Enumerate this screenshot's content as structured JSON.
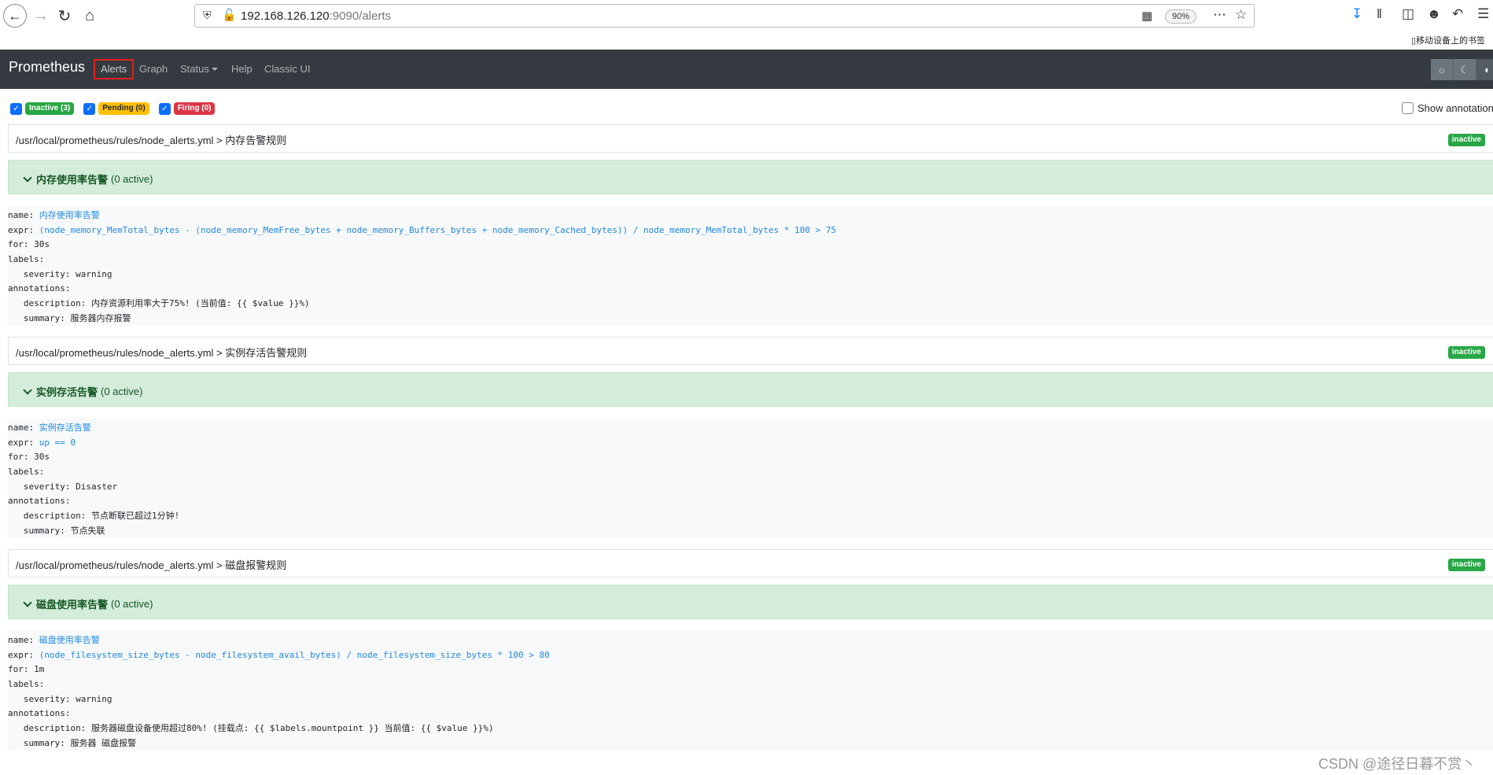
{
  "browser": {
    "url_host": "192.168.126.120",
    "url_rest": ":9090/alerts",
    "zoom": "90%",
    "mobile_bookmarks": "移动设备上的书签"
  },
  "navbar": {
    "brand": "Prometheus",
    "links": [
      "Alerts",
      "Graph",
      "Status",
      "Help",
      "Classic UI"
    ]
  },
  "filters": {
    "inactive": "Inactive (3)",
    "pending": "Pending (0)",
    "firing": "Firing (0)",
    "show_annotations": "Show annotations"
  },
  "groups": [
    {
      "path": "/usr/local/prometheus/rules/node_alerts.yml > 内存告警规则",
      "state": "inactive",
      "rule_name": "内存使用率告警",
      "active": "(0 active)",
      "lines": [
        {
          "key": "name: ",
          "val": "内存使用率告警",
          "blue": true
        },
        {
          "key": "expr: ",
          "val": "(node_memory_MemTotal_bytes - (node_memory_MemFree_bytes + node_memory_Buffers_bytes + node_memory_Cached_bytes)) / node_memory_MemTotal_bytes * 100 > 75",
          "blue": true
        },
        {
          "key": "for: ",
          "val": "30s",
          "blue": false
        },
        {
          "key": "labels:",
          "val": "",
          "blue": false
        },
        {
          "key": "   severity: ",
          "val": "warning",
          "blue": false
        },
        {
          "key": "annotations:",
          "val": "",
          "blue": false
        },
        {
          "key": "   description: ",
          "val": "内存资源利用率大于75%! (当前值: {{ $value }}%)",
          "blue": false
        },
        {
          "key": "   summary: ",
          "val": "服务器内存报警",
          "blue": false
        }
      ]
    },
    {
      "path": "/usr/local/prometheus/rules/node_alerts.yml > 实例存活告警规则",
      "state": "inactive",
      "rule_name": "实例存活告警",
      "active": "(0 active)",
      "lines": [
        {
          "key": "name: ",
          "val": "实例存活告警",
          "blue": true
        },
        {
          "key": "expr: ",
          "val": "up == 0",
          "blue": true
        },
        {
          "key": "for: ",
          "val": "30s",
          "blue": false
        },
        {
          "key": "labels:",
          "val": "",
          "blue": false
        },
        {
          "key": "   severity: ",
          "val": "Disaster",
          "blue": false
        },
        {
          "key": "annotations:",
          "val": "",
          "blue": false
        },
        {
          "key": "   description: ",
          "val": "节点断联已超过1分钟!",
          "blue": false
        },
        {
          "key": "   summary: ",
          "val": "节点失联",
          "blue": false
        }
      ]
    },
    {
      "path": "/usr/local/prometheus/rules/node_alerts.yml > 磁盘报警规则",
      "state": "inactive",
      "rule_name": "磁盘使用率告警",
      "active": "(0 active)",
      "lines": [
        {
          "key": "name: ",
          "val": "磁盘使用率告警",
          "blue": true
        },
        {
          "key": "expr: ",
          "val": "(node_filesystem_size_bytes - node_filesystem_avail_bytes) / node_filesystem_size_bytes * 100 > 80",
          "blue": true
        },
        {
          "key": "for: ",
          "val": "1m",
          "blue": false
        },
        {
          "key": "labels:",
          "val": "",
          "blue": false
        },
        {
          "key": "   severity: ",
          "val": "warning",
          "blue": false
        },
        {
          "key": "annotations:",
          "val": "",
          "blue": false
        },
        {
          "key": "   description: ",
          "val": "服务器磁盘设备使用超过80%! (挂载点: {{ $labels.mountpoint }} 当前值: {{ $value }}%)",
          "blue": false
        },
        {
          "key": "   summary: ",
          "val": "服务器 磁盘报警",
          "blue": false
        }
      ]
    }
  ],
  "watermark": "CSDN @途径日暮不赏丶"
}
